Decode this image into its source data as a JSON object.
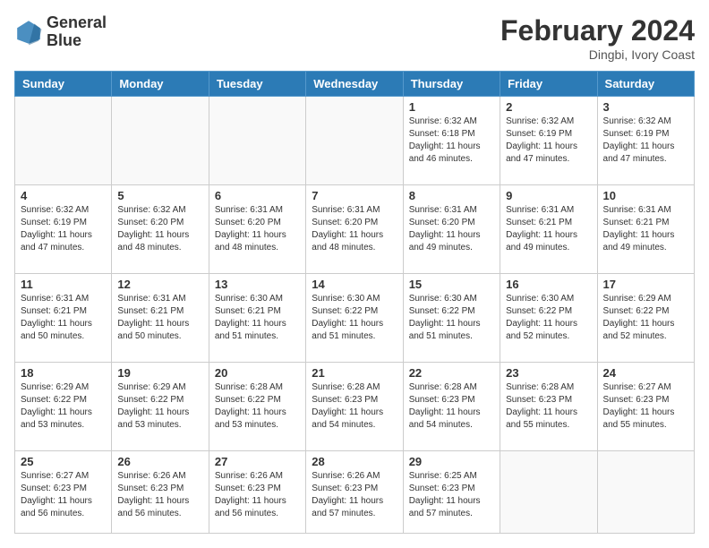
{
  "header": {
    "logo_line1": "General",
    "logo_line2": "Blue",
    "month_title": "February 2024",
    "subtitle": "Dingbi, Ivory Coast"
  },
  "days_of_week": [
    "Sunday",
    "Monday",
    "Tuesday",
    "Wednesday",
    "Thursday",
    "Friday",
    "Saturday"
  ],
  "weeks": [
    [
      {
        "day": "",
        "info": ""
      },
      {
        "day": "",
        "info": ""
      },
      {
        "day": "",
        "info": ""
      },
      {
        "day": "",
        "info": ""
      },
      {
        "day": "1",
        "info": "Sunrise: 6:32 AM\nSunset: 6:18 PM\nDaylight: 11 hours\nand 46 minutes."
      },
      {
        "day": "2",
        "info": "Sunrise: 6:32 AM\nSunset: 6:19 PM\nDaylight: 11 hours\nand 47 minutes."
      },
      {
        "day": "3",
        "info": "Sunrise: 6:32 AM\nSunset: 6:19 PM\nDaylight: 11 hours\nand 47 minutes."
      }
    ],
    [
      {
        "day": "4",
        "info": "Sunrise: 6:32 AM\nSunset: 6:19 PM\nDaylight: 11 hours\nand 47 minutes."
      },
      {
        "day": "5",
        "info": "Sunrise: 6:32 AM\nSunset: 6:20 PM\nDaylight: 11 hours\nand 48 minutes."
      },
      {
        "day": "6",
        "info": "Sunrise: 6:31 AM\nSunset: 6:20 PM\nDaylight: 11 hours\nand 48 minutes."
      },
      {
        "day": "7",
        "info": "Sunrise: 6:31 AM\nSunset: 6:20 PM\nDaylight: 11 hours\nand 48 minutes."
      },
      {
        "day": "8",
        "info": "Sunrise: 6:31 AM\nSunset: 6:20 PM\nDaylight: 11 hours\nand 49 minutes."
      },
      {
        "day": "9",
        "info": "Sunrise: 6:31 AM\nSunset: 6:21 PM\nDaylight: 11 hours\nand 49 minutes."
      },
      {
        "day": "10",
        "info": "Sunrise: 6:31 AM\nSunset: 6:21 PM\nDaylight: 11 hours\nand 49 minutes."
      }
    ],
    [
      {
        "day": "11",
        "info": "Sunrise: 6:31 AM\nSunset: 6:21 PM\nDaylight: 11 hours\nand 50 minutes."
      },
      {
        "day": "12",
        "info": "Sunrise: 6:31 AM\nSunset: 6:21 PM\nDaylight: 11 hours\nand 50 minutes."
      },
      {
        "day": "13",
        "info": "Sunrise: 6:30 AM\nSunset: 6:21 PM\nDaylight: 11 hours\nand 51 minutes."
      },
      {
        "day": "14",
        "info": "Sunrise: 6:30 AM\nSunset: 6:22 PM\nDaylight: 11 hours\nand 51 minutes."
      },
      {
        "day": "15",
        "info": "Sunrise: 6:30 AM\nSunset: 6:22 PM\nDaylight: 11 hours\nand 51 minutes."
      },
      {
        "day": "16",
        "info": "Sunrise: 6:30 AM\nSunset: 6:22 PM\nDaylight: 11 hours\nand 52 minutes."
      },
      {
        "day": "17",
        "info": "Sunrise: 6:29 AM\nSunset: 6:22 PM\nDaylight: 11 hours\nand 52 minutes."
      }
    ],
    [
      {
        "day": "18",
        "info": "Sunrise: 6:29 AM\nSunset: 6:22 PM\nDaylight: 11 hours\nand 53 minutes."
      },
      {
        "day": "19",
        "info": "Sunrise: 6:29 AM\nSunset: 6:22 PM\nDaylight: 11 hours\nand 53 minutes."
      },
      {
        "day": "20",
        "info": "Sunrise: 6:28 AM\nSunset: 6:22 PM\nDaylight: 11 hours\nand 53 minutes."
      },
      {
        "day": "21",
        "info": "Sunrise: 6:28 AM\nSunset: 6:23 PM\nDaylight: 11 hours\nand 54 minutes."
      },
      {
        "day": "22",
        "info": "Sunrise: 6:28 AM\nSunset: 6:23 PM\nDaylight: 11 hours\nand 54 minutes."
      },
      {
        "day": "23",
        "info": "Sunrise: 6:28 AM\nSunset: 6:23 PM\nDaylight: 11 hours\nand 55 minutes."
      },
      {
        "day": "24",
        "info": "Sunrise: 6:27 AM\nSunset: 6:23 PM\nDaylight: 11 hours\nand 55 minutes."
      }
    ],
    [
      {
        "day": "25",
        "info": "Sunrise: 6:27 AM\nSunset: 6:23 PM\nDaylight: 11 hours\nand 56 minutes."
      },
      {
        "day": "26",
        "info": "Sunrise: 6:26 AM\nSunset: 6:23 PM\nDaylight: 11 hours\nand 56 minutes."
      },
      {
        "day": "27",
        "info": "Sunrise: 6:26 AM\nSunset: 6:23 PM\nDaylight: 11 hours\nand 56 minutes."
      },
      {
        "day": "28",
        "info": "Sunrise: 6:26 AM\nSunset: 6:23 PM\nDaylight: 11 hours\nand 57 minutes."
      },
      {
        "day": "29",
        "info": "Sunrise: 6:25 AM\nSunset: 6:23 PM\nDaylight: 11 hours\nand 57 minutes."
      },
      {
        "day": "",
        "info": ""
      },
      {
        "day": "",
        "info": ""
      }
    ]
  ]
}
